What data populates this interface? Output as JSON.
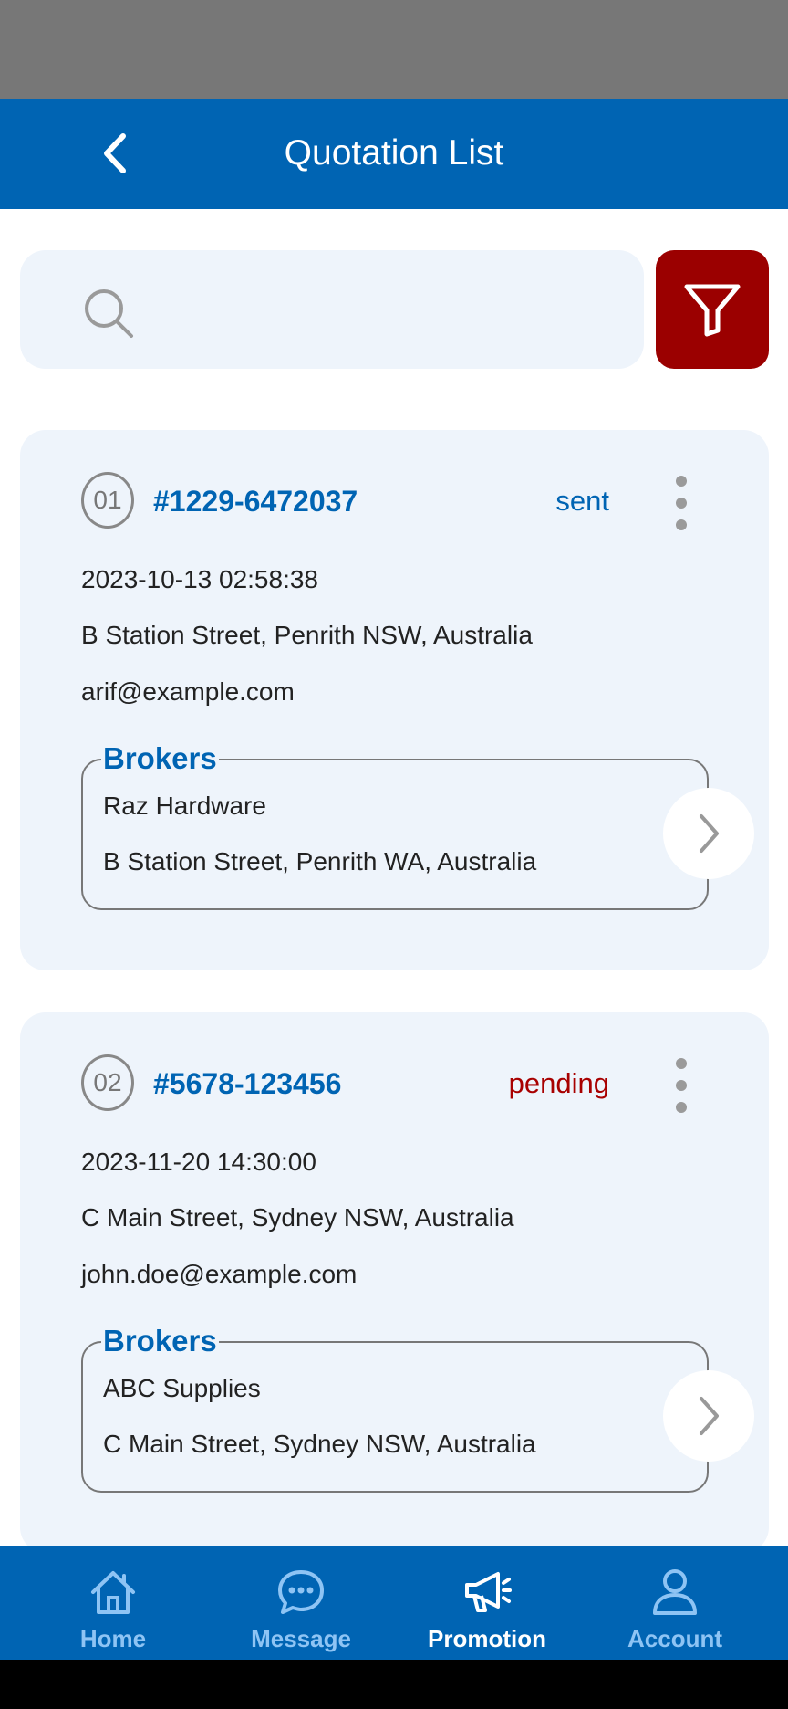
{
  "header": {
    "title": "Quotation List"
  },
  "search": {
    "placeholder": "",
    "value": ""
  },
  "colors": {
    "primary": "#0064b3",
    "filter": "#9b0000",
    "card_bg": "#eef4fb",
    "status_sent": "#0064b3",
    "status_pending": "#a80000",
    "nav_inactive": "#8ec4f4"
  },
  "icons": {
    "back": "chevron-left-icon",
    "search": "search-icon",
    "filter": "filter-icon",
    "more": "more-vertical-icon",
    "arrow": "chevron-right-icon"
  },
  "quotations": [
    {
      "number": "01",
      "id": "#1229-6472037",
      "status": "sent",
      "datetime": "2023-10-13 02:58:38",
      "address": "B Station Street, Penrith NSW, Australia",
      "email": "arif@example.com",
      "brokers_label": "Brokers",
      "broker_name": "Raz Hardware",
      "broker_address": "B Station Street, Penrith WA, Australia"
    },
    {
      "number": "02",
      "id": "#5678-123456",
      "status": "pending",
      "datetime": "2023-11-20 14:30:00",
      "address": "C Main Street, Sydney NSW, Australia",
      "email": "john.doe@example.com",
      "brokers_label": "Brokers",
      "broker_name": "ABC Supplies",
      "broker_address": "C Main Street, Sydney NSW, Australia"
    }
  ],
  "nav": {
    "active": "Promotion",
    "items": [
      {
        "label": "Home",
        "icon": "home-icon"
      },
      {
        "label": "Message",
        "icon": "chat-icon"
      },
      {
        "label": "Promotion",
        "icon": "megaphone-icon"
      },
      {
        "label": "Account",
        "icon": "user-icon"
      }
    ]
  }
}
